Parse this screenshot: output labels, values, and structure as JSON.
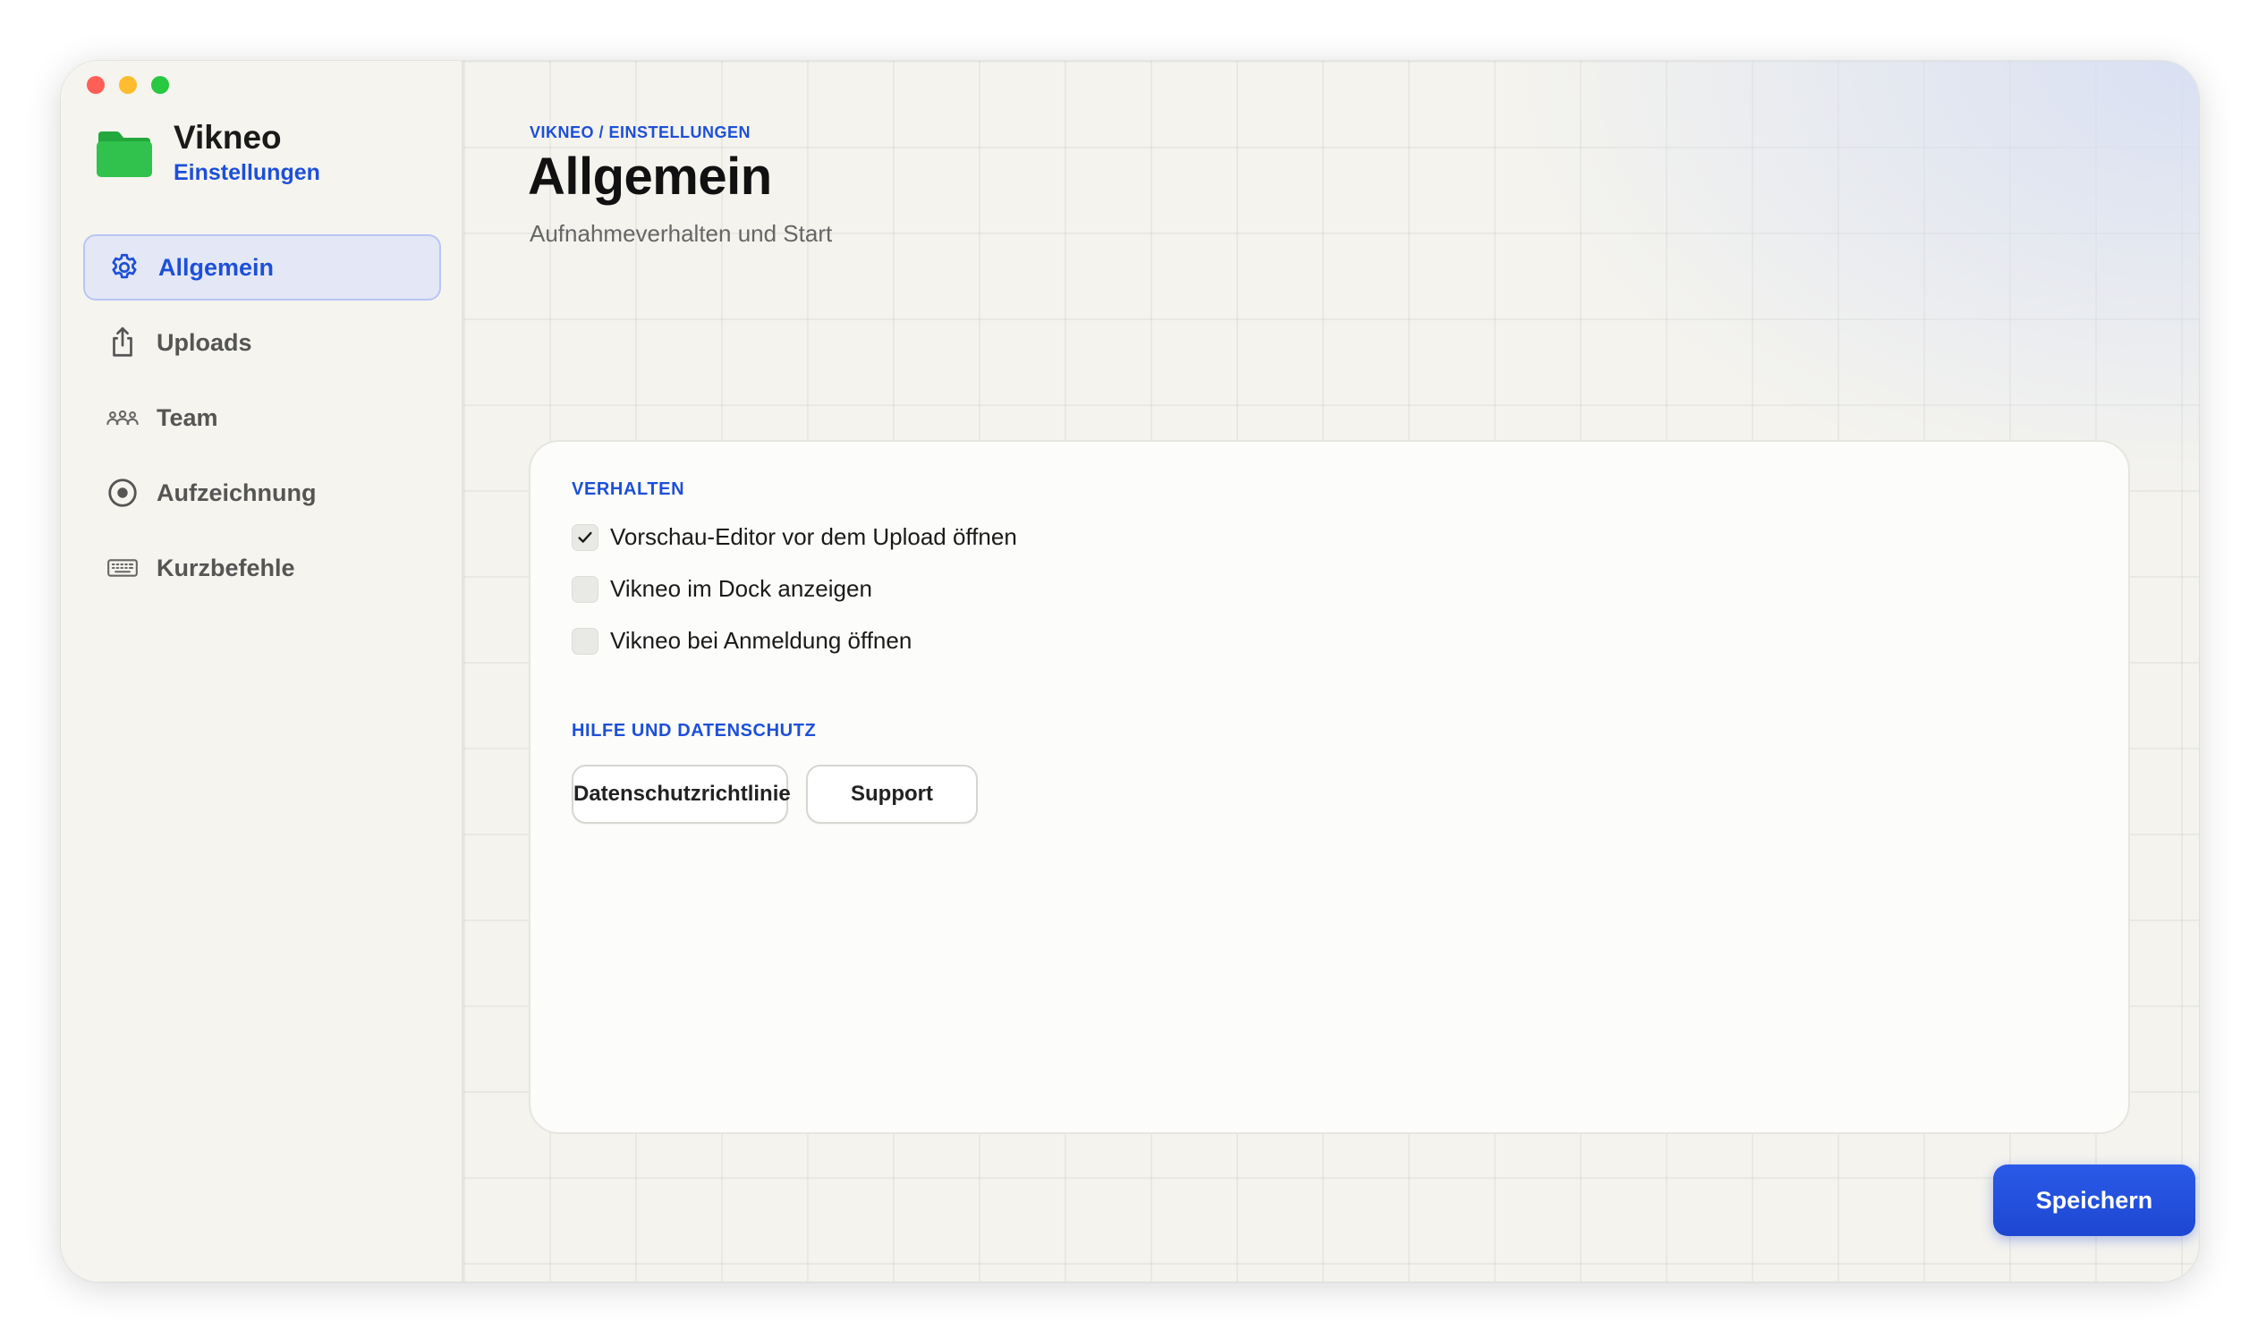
{
  "app": {
    "name": "Vikneo",
    "subtitle": "Einstellungen"
  },
  "sidebar": {
    "items": [
      {
        "label": "Allgemein",
        "icon": "gear-icon",
        "active": true
      },
      {
        "label": "Uploads",
        "icon": "share-upload-icon",
        "active": false
      },
      {
        "label": "Team",
        "icon": "team-icon",
        "active": false
      },
      {
        "label": "Aufzeichnung",
        "icon": "record-icon",
        "active": false
      },
      {
        "label": "Kurzbefehle",
        "icon": "keyboard-icon",
        "active": false
      }
    ]
  },
  "header": {
    "breadcrumb": "VIKNEO / EINSTELLUNGEN",
    "title": "Allgemein",
    "subtitle": "Aufnahmeverhalten und Start"
  },
  "behavior": {
    "section_label": "VERHALTEN",
    "options": [
      {
        "label": "Vorschau-Editor vor dem Upload öffnen",
        "checked": true
      },
      {
        "label": "Vikneo im Dock anzeigen",
        "checked": false
      },
      {
        "label": "Vikneo bei Anmeldung öffnen",
        "checked": false
      }
    ]
  },
  "help": {
    "section_label": "HILFE UND DATENSCHUTZ",
    "privacy_label": "Datenschutzrichtlinie",
    "support_label": "Support"
  },
  "footer": {
    "save_label": "Speichern"
  },
  "colors": {
    "accent": "#1d4fd8",
    "folder": "#2fbf4a"
  }
}
